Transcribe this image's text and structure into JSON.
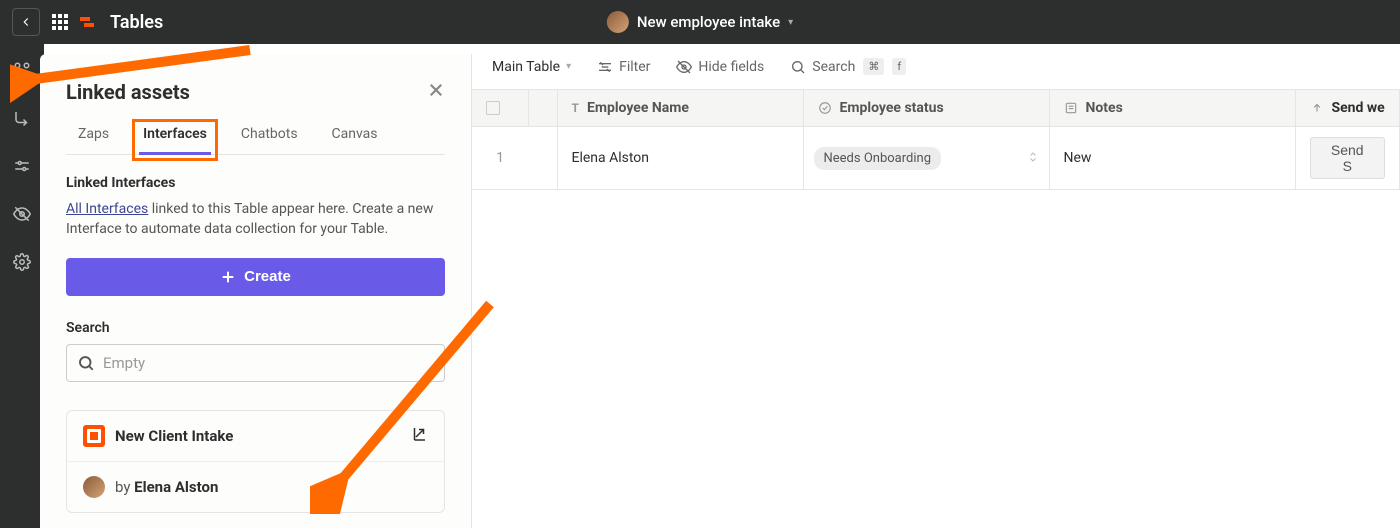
{
  "topbar": {
    "app_title": "Tables",
    "table_name": "New employee intake"
  },
  "panel": {
    "title": "Linked assets",
    "tabs": {
      "zaps": "Zaps",
      "interfaces": "Interfaces",
      "chatbots": "Chatbots",
      "canvas": "Canvas"
    },
    "section_title": "Linked Interfaces",
    "all_interfaces_link": "All Interfaces",
    "section_desc_suffix": " linked to this Table appear here. Create a new Interface to automate data collection for your Table.",
    "create_label": "Create",
    "search_label": "Search",
    "search_placeholder": "Empty",
    "card": {
      "title": "New Client Intake",
      "by_prefix": "by ",
      "author": "Elena Alston"
    }
  },
  "toolbar": {
    "main_table": "Main Table",
    "filter": "Filter",
    "hide_fields": "Hide fields",
    "search": "Search",
    "kbd1": "⌘",
    "kbd2": "f"
  },
  "table": {
    "headers": {
      "employee_name": "Employee Name",
      "employee_status": "Employee status",
      "notes": "Notes",
      "send_welcome": "Send we"
    },
    "row1": {
      "num": "1",
      "name": "Elena Alston",
      "status": "Needs Onboarding",
      "notes": "New",
      "action": "Send S"
    }
  }
}
